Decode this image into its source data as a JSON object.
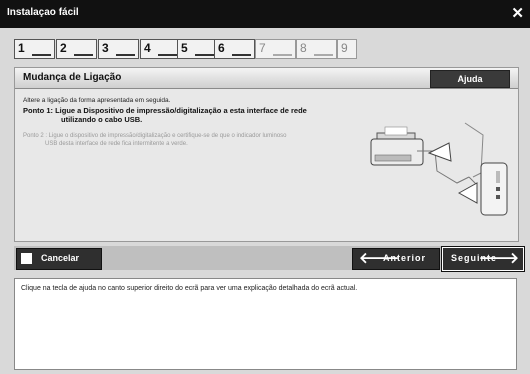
{
  "window": {
    "title": "Instalaçao fácil"
  },
  "steps": [
    {
      "num": "1",
      "active": true
    },
    {
      "num": "2",
      "active": true
    },
    {
      "num": "3",
      "active": true
    },
    {
      "num": "4",
      "active": true
    },
    {
      "num": "5",
      "active": true
    },
    {
      "num": "6",
      "active": true
    },
    {
      "num": "7",
      "active": false
    },
    {
      "num": "8",
      "active": false
    },
    {
      "num": "9",
      "active": false
    }
  ],
  "panel": {
    "title": "Mudança de Ligação",
    "help_label": "Ajuda",
    "intro": "Altere a ligação da forma apresentada em seguida.",
    "point1_line1": "Ponto 1: Ligue a Dispositivo de impressão/digitalização a esta interface de rede",
    "point1_line2": "utilizando o cabo USB.",
    "point2_line1": "Ponto 2 : Ligue o dispositivo de impressão/digitalização e certifique-se de que o indicador luminoso",
    "point2_line2": "USB desta interface de rede fica intermitente a verde."
  },
  "buttons": {
    "cancel": "Cancelar",
    "previous": "Anterior",
    "next": "Seguinte"
  },
  "message": "Clique na tecla de ajuda no canto superior direito do ecrã para ver uma explicação detalhada do ecrã actual.",
  "colors": {
    "titlebar": "#111111",
    "button_dark": "#2f2f2f",
    "window_bg": "#d9d9d9"
  }
}
